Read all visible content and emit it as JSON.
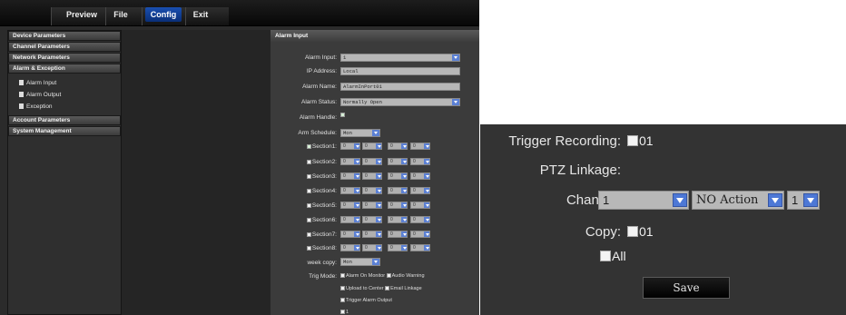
{
  "menu": {
    "items": [
      "Preview",
      "File",
      "Config",
      "Exit"
    ],
    "active": "Config"
  },
  "sidebar": {
    "sections": [
      "Device Parameters",
      "Channel Parameters",
      "Network Parameters",
      "Alarm & Exception",
      "Account Parameters",
      "System Management"
    ],
    "subitems": [
      "Alarm Input",
      "Alarm Output",
      "Exception"
    ]
  },
  "panel": {
    "title": "Alarm Input",
    "alarm_input_label": "Alarm Input:",
    "alarm_input_value": "1",
    "ip_label": "IP Address:",
    "ip_value": "Local",
    "name_label": "Alarm Name:",
    "name_value": "AlarmInPort01",
    "status_label": "Alarm Status:",
    "status_value": "Normally Open",
    "handle_label": "Alarm Handle:",
    "schedule_label": "Arm Schedule:",
    "schedule_value": "Mon",
    "sections": [
      "Section1:",
      "Section2:",
      "Section3:",
      "Section4:",
      "Section5:",
      "Section6:",
      "Section7:",
      "Section8:"
    ],
    "time_value": "0",
    "week_copy_label": "week copy:",
    "week_copy_value": "Mon",
    "trig_label": "Trig Mode:",
    "trig_options": [
      "Alarm On Monitor",
      "Audio Warning",
      "Upload to Center",
      "Email Linkage",
      "Trigger Alarm Output",
      "1"
    ]
  },
  "zoom": {
    "trigger_label": "Trigger Recording:",
    "trigger_value": "01",
    "ptz_label": "PTZ Linkage:",
    "channel_label": "Channel:",
    "channel_value": "1",
    "action_value": "NO Action",
    "preset_value": "1",
    "copy_label": "Copy:",
    "copy_value": "01",
    "all_label": "All",
    "save_label": "Save"
  }
}
